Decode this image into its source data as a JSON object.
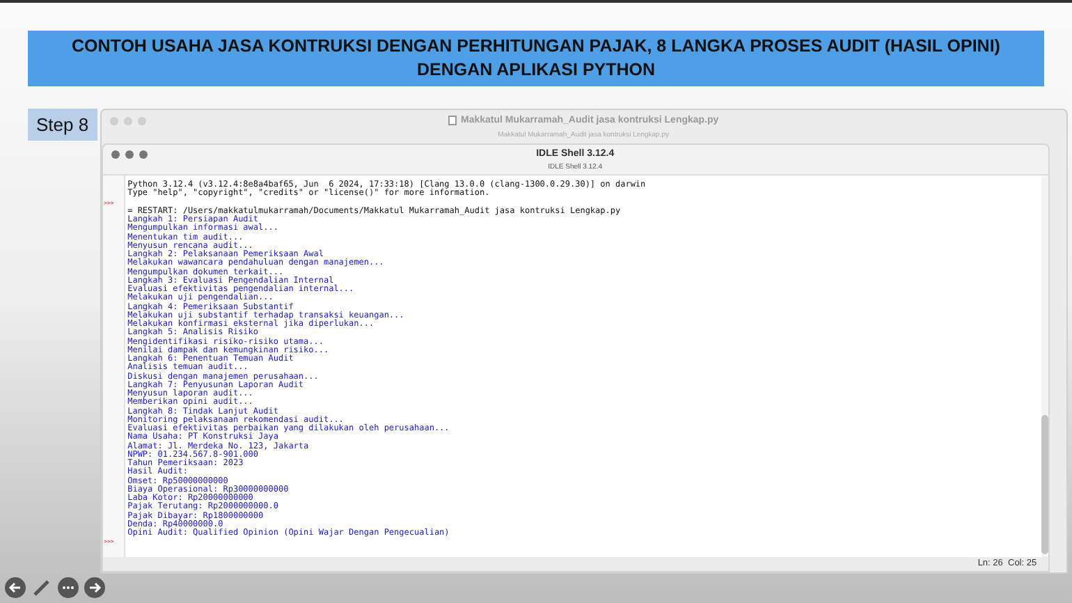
{
  "slide_title": "CONTOH USAHA JASA KONTRUKSI DENGAN PERHITUNGAN PAJAK, 8 LANGKA PROSES AUDIT (HASIL OPINI) DENGAN APLIKASI PYTHON",
  "step_label": "Step 8",
  "editor_window": {
    "title": "Makkatul Mukarramah_Audit jasa kontruksi Lengkap.py",
    "subtitle": "Makkatul Mukarramah_Audit jasa kontruksi Lengkap.py"
  },
  "shell_window": {
    "title": "IDLE Shell 3.12.4",
    "subtitle": "IDLE Shell 3.12.4",
    "lines": [
      {
        "kind": "info",
        "text": "Python 3.12.4 (v3.12.4:8e8a4baf65, Jun  6 2024, 17:33:18) [Clang 13.0.0 (clang-1300.0.29.30)] on darwin"
      },
      {
        "kind": "info",
        "text": "Type \"help\", \"copyright\", \"credits\" or \"license()\" for more information."
      },
      {
        "kind": "prompt",
        "text": ">>>"
      },
      {
        "kind": "info",
        "text": "= RESTART: /Users/makkatulmukarramah/Documents/Makkatul Mukarramah_Audit jasa kontruksi Lengkap.py"
      },
      {
        "kind": "output",
        "text": "Langkah 1: Persiapan Audit"
      },
      {
        "kind": "output",
        "text": "Mengumpulkan informasi awal..."
      },
      {
        "kind": "output",
        "text": "Menentukan tim audit..."
      },
      {
        "kind": "output",
        "text": "Menyusun rencana audit..."
      },
      {
        "kind": "output",
        "text": "Langkah 2: Pelaksanaan Pemeriksaan Awal"
      },
      {
        "kind": "output",
        "text": "Melakukan wawancara pendahuluan dengan manajemen..."
      },
      {
        "kind": "output",
        "text": "Mengumpulkan dokumen terkait..."
      },
      {
        "kind": "output",
        "text": "Langkah 3: Evaluasi Pengendalian Internal"
      },
      {
        "kind": "output",
        "text": "Evaluasi efektivitas pengendalian internal..."
      },
      {
        "kind": "output",
        "text": "Melakukan uji pengendalian..."
      },
      {
        "kind": "output",
        "text": "Langkah 4: Pemeriksaan Substantif"
      },
      {
        "kind": "output",
        "text": "Melakukan uji substantif terhadap transaksi keuangan..."
      },
      {
        "kind": "output",
        "text": "Melakukan konfirmasi eksternal jika diperlukan..."
      },
      {
        "kind": "output",
        "text": "Langkah 5: Analisis Risiko"
      },
      {
        "kind": "output",
        "text": "Mengidentifikasi risiko-risiko utama..."
      },
      {
        "kind": "output",
        "text": "Menilai dampak dan kemungkinan risiko..."
      },
      {
        "kind": "output",
        "text": "Langkah 6: Penentuan Temuan Audit"
      },
      {
        "kind": "output",
        "text": "Analisis temuan audit..."
      },
      {
        "kind": "output",
        "text": "Diskusi dengan manajemen perusahaan..."
      },
      {
        "kind": "output",
        "text": "Langkah 7: Penyusunan Laporan Audit"
      },
      {
        "kind": "output",
        "text": "Menyusun laporan audit..."
      },
      {
        "kind": "output",
        "text": "Memberikan opini audit..."
      },
      {
        "kind": "output",
        "text": "Langkah 8: Tindak Lanjut Audit"
      },
      {
        "kind": "output",
        "text": "Monitoring pelaksanaan rekomendasi audit..."
      },
      {
        "kind": "output",
        "text": "Evaluasi efektivitas perbaikan yang dilakukan oleh perusahaan..."
      },
      {
        "kind": "output",
        "text": "Nama Usaha: PT Konstruksi Jaya"
      },
      {
        "kind": "output",
        "text": "Alamat: Jl. Merdeka No. 123, Jakarta"
      },
      {
        "kind": "output",
        "text": "NPWP: 01.234.567.8-901.000"
      },
      {
        "kind": "output",
        "text": "Tahun Pemeriksaan: 2023"
      },
      {
        "kind": "output",
        "text": "Hasil Audit:"
      },
      {
        "kind": "output",
        "text": "Omset: Rp50000000000"
      },
      {
        "kind": "output",
        "text": "Biaya Operasional: Rp30000000000"
      },
      {
        "kind": "output",
        "text": "Laba Kotor: Rp20000000000"
      },
      {
        "kind": "output",
        "text": "Pajak Terutang: Rp2000000000.0"
      },
      {
        "kind": "output",
        "text": "Pajak Dibayar: Rp1800000000"
      },
      {
        "kind": "output",
        "text": "Denda: Rp40000000.0"
      },
      {
        "kind": "output",
        "text": "Opini Audit: Qualified Opinion (Opini Wajar Dengan Pengecualian)"
      },
      {
        "kind": "prompt",
        "text": ">>>"
      }
    ],
    "status": "Ln: 26  Col: 25"
  }
}
